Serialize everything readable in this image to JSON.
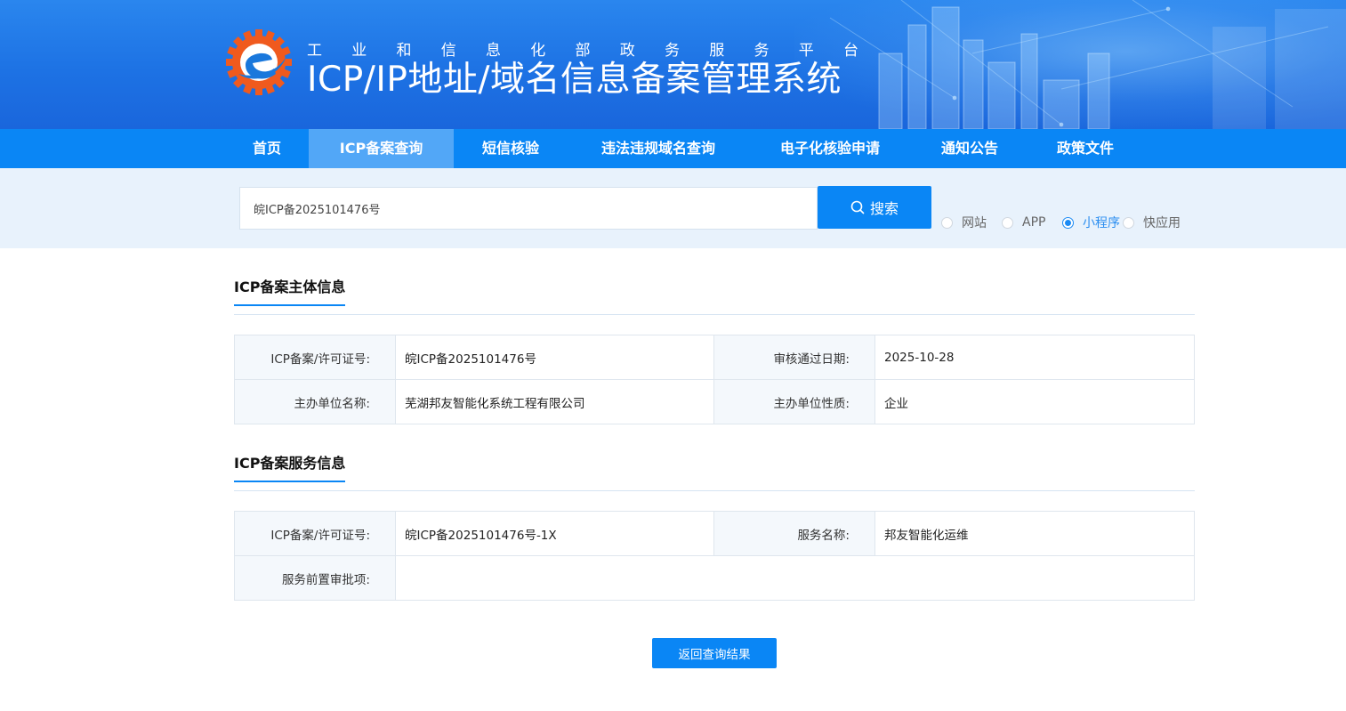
{
  "header": {
    "subtitle_chars": [
      "工",
      "业",
      "和",
      "信",
      "息",
      "化",
      "部",
      "政",
      "务",
      "服",
      "务",
      "平",
      "台"
    ],
    "title": "ICP/IP地址/域名信息备案管理系统",
    "logo_icon": "gear-e-logo-icon"
  },
  "nav": {
    "items": [
      {
        "label": "首页",
        "active": false
      },
      {
        "label": "ICP备案查询",
        "active": true
      },
      {
        "label": "短信核验",
        "active": false
      },
      {
        "label": "违法违规域名查询",
        "active": false
      },
      {
        "label": "电子化核验申请",
        "active": false
      },
      {
        "label": "通知公告",
        "active": false
      },
      {
        "label": "政策文件",
        "active": false
      }
    ]
  },
  "search": {
    "value": "皖ICP备2025101476号",
    "button_label": "搜索",
    "button_icon": "search-icon",
    "types": [
      {
        "label": "网站",
        "checked": false
      },
      {
        "label": "APP",
        "checked": false
      },
      {
        "label": "小程序",
        "checked": true
      },
      {
        "label": "快应用",
        "checked": false
      }
    ]
  },
  "subject": {
    "heading": "ICP备案主体信息",
    "license_label": "ICP备案/许可证号:",
    "license_value": "皖ICP备2025101476号",
    "date_label": "审核通过日期:",
    "date_value": "2025-10-28",
    "org_label": "主办单位名称:",
    "org_value": "芜湖邦友智能化系统工程有限公司",
    "nature_label": "主办单位性质:",
    "nature_value": "企业"
  },
  "service": {
    "heading": "ICP备案服务信息",
    "license_label": "ICP备案/许可证号:",
    "license_value": "皖ICP备2025101476号-1X",
    "name_label": "服务名称:",
    "name_value": "邦友智能化运维",
    "approval_label": "服务前置审批项:",
    "approval_value": ""
  },
  "back_button_label": "返回查询结果",
  "colors": {
    "primary": "#0a86f5",
    "nav_active": "#52a7f7",
    "search_band": "#e8f2fc",
    "label_bg": "#f4f8fc",
    "logo_orange": "#f05a1e",
    "logo_blue": "#1a78dc"
  }
}
